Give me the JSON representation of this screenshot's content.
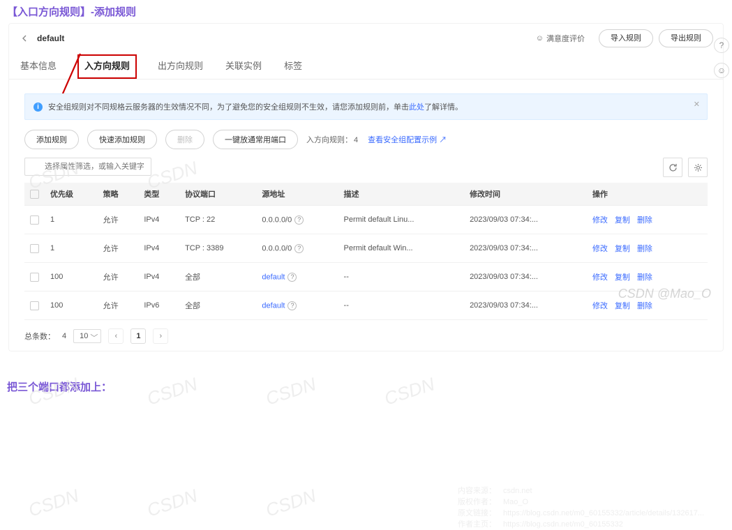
{
  "headings": {
    "title": "【入口方向规则】-添加规则",
    "note": "把三个端口都添加上："
  },
  "topbar": {
    "breadcrumb": "default",
    "satisfaction": "满意度评价",
    "import_btn": "导入规则",
    "export_btn": "导出规则"
  },
  "tabs": [
    "基本信息",
    "入方向规则",
    "出方向规则",
    "关联实例",
    "标签"
  ],
  "active_tab_index": 1,
  "alert": {
    "text_a": "安全组规则对不同规格云服务器的生效情况不同，为了避免您的安全组规则不生效，请您添加规则前，单击",
    "link": "此处",
    "text_b": "了解详情。"
  },
  "buttons": {
    "add": "添加规则",
    "quick": "快速添加规则",
    "delete": "删除",
    "oneclick": "一键放通常用端口"
  },
  "count": {
    "label": "入方向规则：",
    "n": "4"
  },
  "example_link": "查看安全组配置示例",
  "search": {
    "placeholder": "选择属性筛选，或输入关键字搜索"
  },
  "columns": [
    "优先级",
    "策略",
    "类型",
    "协议端口",
    "源地址",
    "描述",
    "修改时间",
    "操作"
  ],
  "rows": [
    {
      "priority": "1",
      "policy": "允许",
      "type": "IPv4",
      "port": "TCP : 22",
      "src": "0.0.0.0/0",
      "src_q": true,
      "src_link": false,
      "desc": "Permit default Linu...",
      "mtime": "2023/09/03 07:34:..."
    },
    {
      "priority": "1",
      "policy": "允许",
      "type": "IPv4",
      "port": "TCP : 3389",
      "src": "0.0.0.0/0",
      "src_q": true,
      "src_link": false,
      "desc": "Permit default Win...",
      "mtime": "2023/09/03 07:34:..."
    },
    {
      "priority": "100",
      "policy": "允许",
      "type": "IPv4",
      "port": "全部",
      "src": "default",
      "src_q": true,
      "src_link": true,
      "desc": "--",
      "mtime": "2023/09/03 07:34:..."
    },
    {
      "priority": "100",
      "policy": "允许",
      "type": "IPv6",
      "port": "全部",
      "src": "default",
      "src_q": true,
      "src_link": true,
      "desc": "--",
      "mtime": "2023/09/03 07:34:..."
    }
  ],
  "ops": {
    "modify": "修改",
    "copy": "复制",
    "delete": "删除"
  },
  "pager": {
    "total_label": "总条数：",
    "total": "4",
    "pagesize": "10",
    "page": "1"
  },
  "watermark": "CSDN @Mao_O",
  "csdn": "CSDN",
  "footnotes": {
    "r1a": "内容来源：",
    "r1b": "csdn.net",
    "r2a": "版权作者：",
    "r2b": "Mao_O",
    "r3a": "原文链接：",
    "r3b": "https://blog.csdn.net/m0_60155332/article/details/132617...",
    "r4a": "作者主页：",
    "r4b": "https://blog.csdn.net/m0_60155332"
  },
  "side": {
    "help": "?",
    "smile": "☺"
  },
  "ext_icon": "↗"
}
